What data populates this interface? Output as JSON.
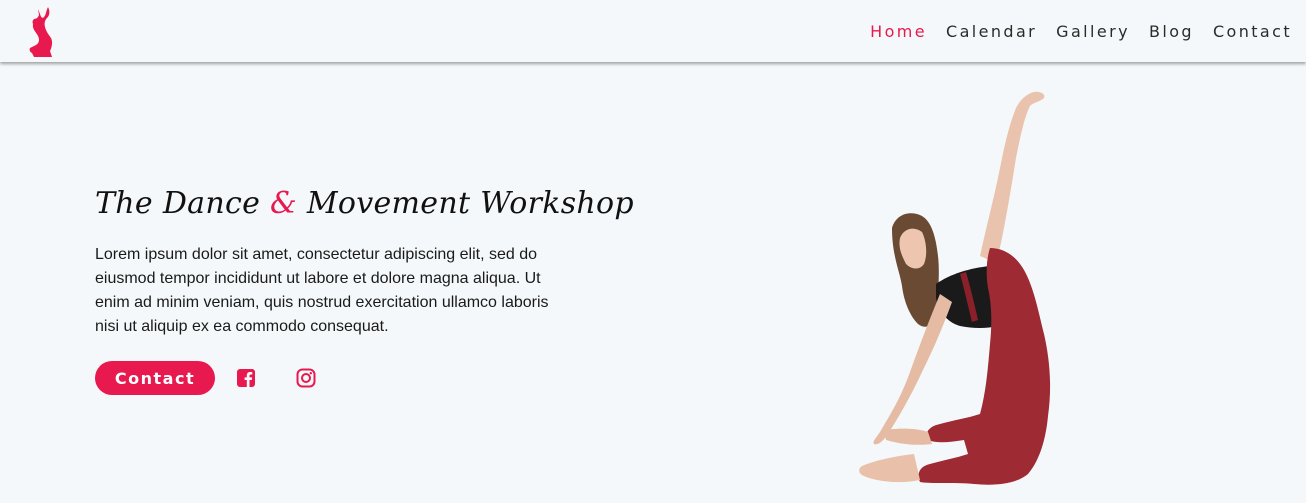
{
  "nav": {
    "items": [
      "Home",
      "Calendar",
      "Gallery",
      "Blog",
      "Contact"
    ],
    "active": "Home"
  },
  "hero": {
    "title_part1": "The Dance ",
    "title_amp": "&",
    "title_part2": " Movement Workshop",
    "description": "Lorem ipsum dolor sit amet, consectetur adipiscing elit, sed do eiusmod tempor incididunt ut labore et dolore magna aliqua. Ut enim ad minim veniam, quis nostrud exercitation ullamco laboris nisi ut aliquip ex ea commodo consequat.",
    "contact_label": "Contact"
  },
  "icons": {
    "logo": "dancer-logo-icon",
    "facebook": "facebook-icon",
    "instagram": "instagram-icon"
  },
  "colors": {
    "accent": "#e8194f",
    "background": "#f5f8fa",
    "text": "#111111",
    "overalls": "#9e2a33"
  }
}
